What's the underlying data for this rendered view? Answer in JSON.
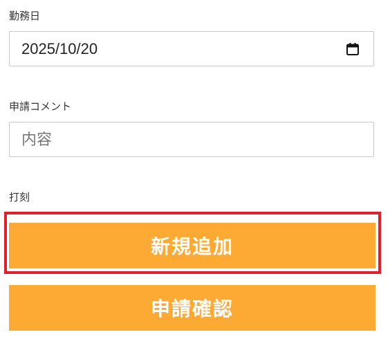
{
  "work_date": {
    "label": "勤務日",
    "value": "2025/10/20",
    "icon": "calendar-icon"
  },
  "comment": {
    "label": "申請コメント",
    "placeholder": "内容",
    "value": ""
  },
  "punch": {
    "label": "打刻"
  },
  "buttons": {
    "add_new": "新規追加",
    "confirm_request": "申請確認"
  },
  "colors": {
    "button_bg": "#fcaa34",
    "button_text": "#ffffff",
    "highlight": "#e0202c"
  }
}
